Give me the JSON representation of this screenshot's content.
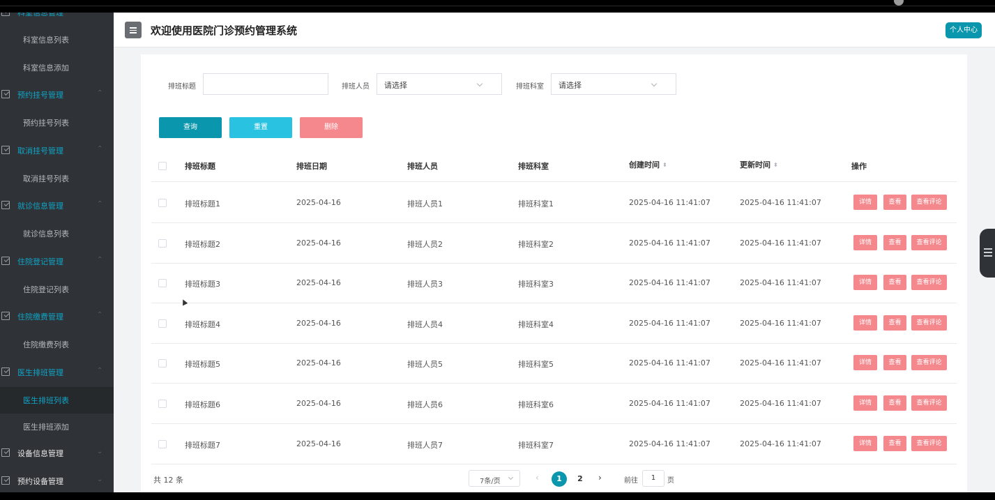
{
  "sidebar": {
    "top_cut_label": "科室信息管理",
    "items": [
      {
        "type": "item",
        "label": "科室信息列表"
      },
      {
        "type": "item",
        "label": "科室信息添加"
      },
      {
        "type": "group",
        "label": "预约挂号管理"
      },
      {
        "type": "item",
        "label": "预约挂号列表"
      },
      {
        "type": "group",
        "label": "取消挂号管理"
      },
      {
        "type": "item",
        "label": "取消挂号列表"
      },
      {
        "type": "group",
        "label": "就诊信息管理"
      },
      {
        "type": "item",
        "label": "就诊信息列表"
      },
      {
        "type": "group",
        "label": "住院登记管理"
      },
      {
        "type": "item",
        "label": "住院登记列表"
      },
      {
        "type": "group",
        "label": "住院缴费管理"
      },
      {
        "type": "item",
        "label": "住院缴费列表"
      },
      {
        "type": "group",
        "label": "医生排班管理"
      },
      {
        "type": "item",
        "label": "医生排班列表",
        "active": true
      },
      {
        "type": "item",
        "label": "医生排班添加"
      },
      {
        "type": "group",
        "label": "设备信息管理"
      },
      {
        "type": "group",
        "label": "预约设备管理"
      }
    ]
  },
  "header": {
    "title": "欢迎使用医院门诊预约管理系统",
    "profile_button": "个人中心"
  },
  "filters": {
    "title_label": "排班标题",
    "title_value": "",
    "staff_label": "排班人员",
    "staff_placeholder": "请选择",
    "dept_label": "排班科室",
    "dept_placeholder": "请选择"
  },
  "actions": {
    "query": "查询",
    "reset": "重置",
    "delete": "删除"
  },
  "table": {
    "columns": [
      "排班标题",
      "排班日期",
      "排班人员",
      "排班科室",
      "创建时间",
      "更新时间",
      "操作"
    ],
    "rows": [
      [
        "排班标题1",
        "2025-04-16",
        "排班人员1",
        "排班科室1",
        "2025-04-16 11:41:07",
        "2025-04-16 11:41:07"
      ],
      [
        "排班标题2",
        "2025-04-16",
        "排班人员2",
        "排班科室2",
        "2025-04-16 11:41:07",
        "2025-04-16 11:41:07"
      ],
      [
        "排班标题3",
        "2025-04-16",
        "排班人员3",
        "排班科室3",
        "2025-04-16 11:41:07",
        "2025-04-16 11:41:07"
      ],
      [
        "排班标题4",
        "2025-04-16",
        "排班人员4",
        "排班科室4",
        "2025-04-16 11:41:07",
        "2025-04-16 11:41:07"
      ],
      [
        "排班标题5",
        "2025-04-16",
        "排班人员5",
        "排班科室5",
        "2025-04-16 11:41:07",
        "2025-04-16 11:41:07"
      ],
      [
        "排班标题6",
        "2025-04-16",
        "排班人员6",
        "排班科室6",
        "2025-04-16 11:41:07",
        "2025-04-16 11:41:07"
      ],
      [
        "排班标题7",
        "2025-04-16",
        "排班人员7",
        "排班科室7",
        "2025-04-16 11:41:07",
        "2025-04-16 11:41:07"
      ]
    ],
    "row_actions": [
      "详情",
      "查看",
      "查看评论"
    ]
  },
  "pagination": {
    "total": "共 12 条",
    "page_size": "7条/页",
    "pages": [
      "1",
      "2"
    ],
    "current": "1",
    "goto_label": "前往",
    "goto_value": "1",
    "goto_unit": "页"
  },
  "colors": {
    "accent": "#0a97ad",
    "sidebar_bg": "#2f3236",
    "sidebar_group_text": "#0fa5c7",
    "delete_btn": "#f5888d",
    "reset_btn": "#29c2e0"
  }
}
